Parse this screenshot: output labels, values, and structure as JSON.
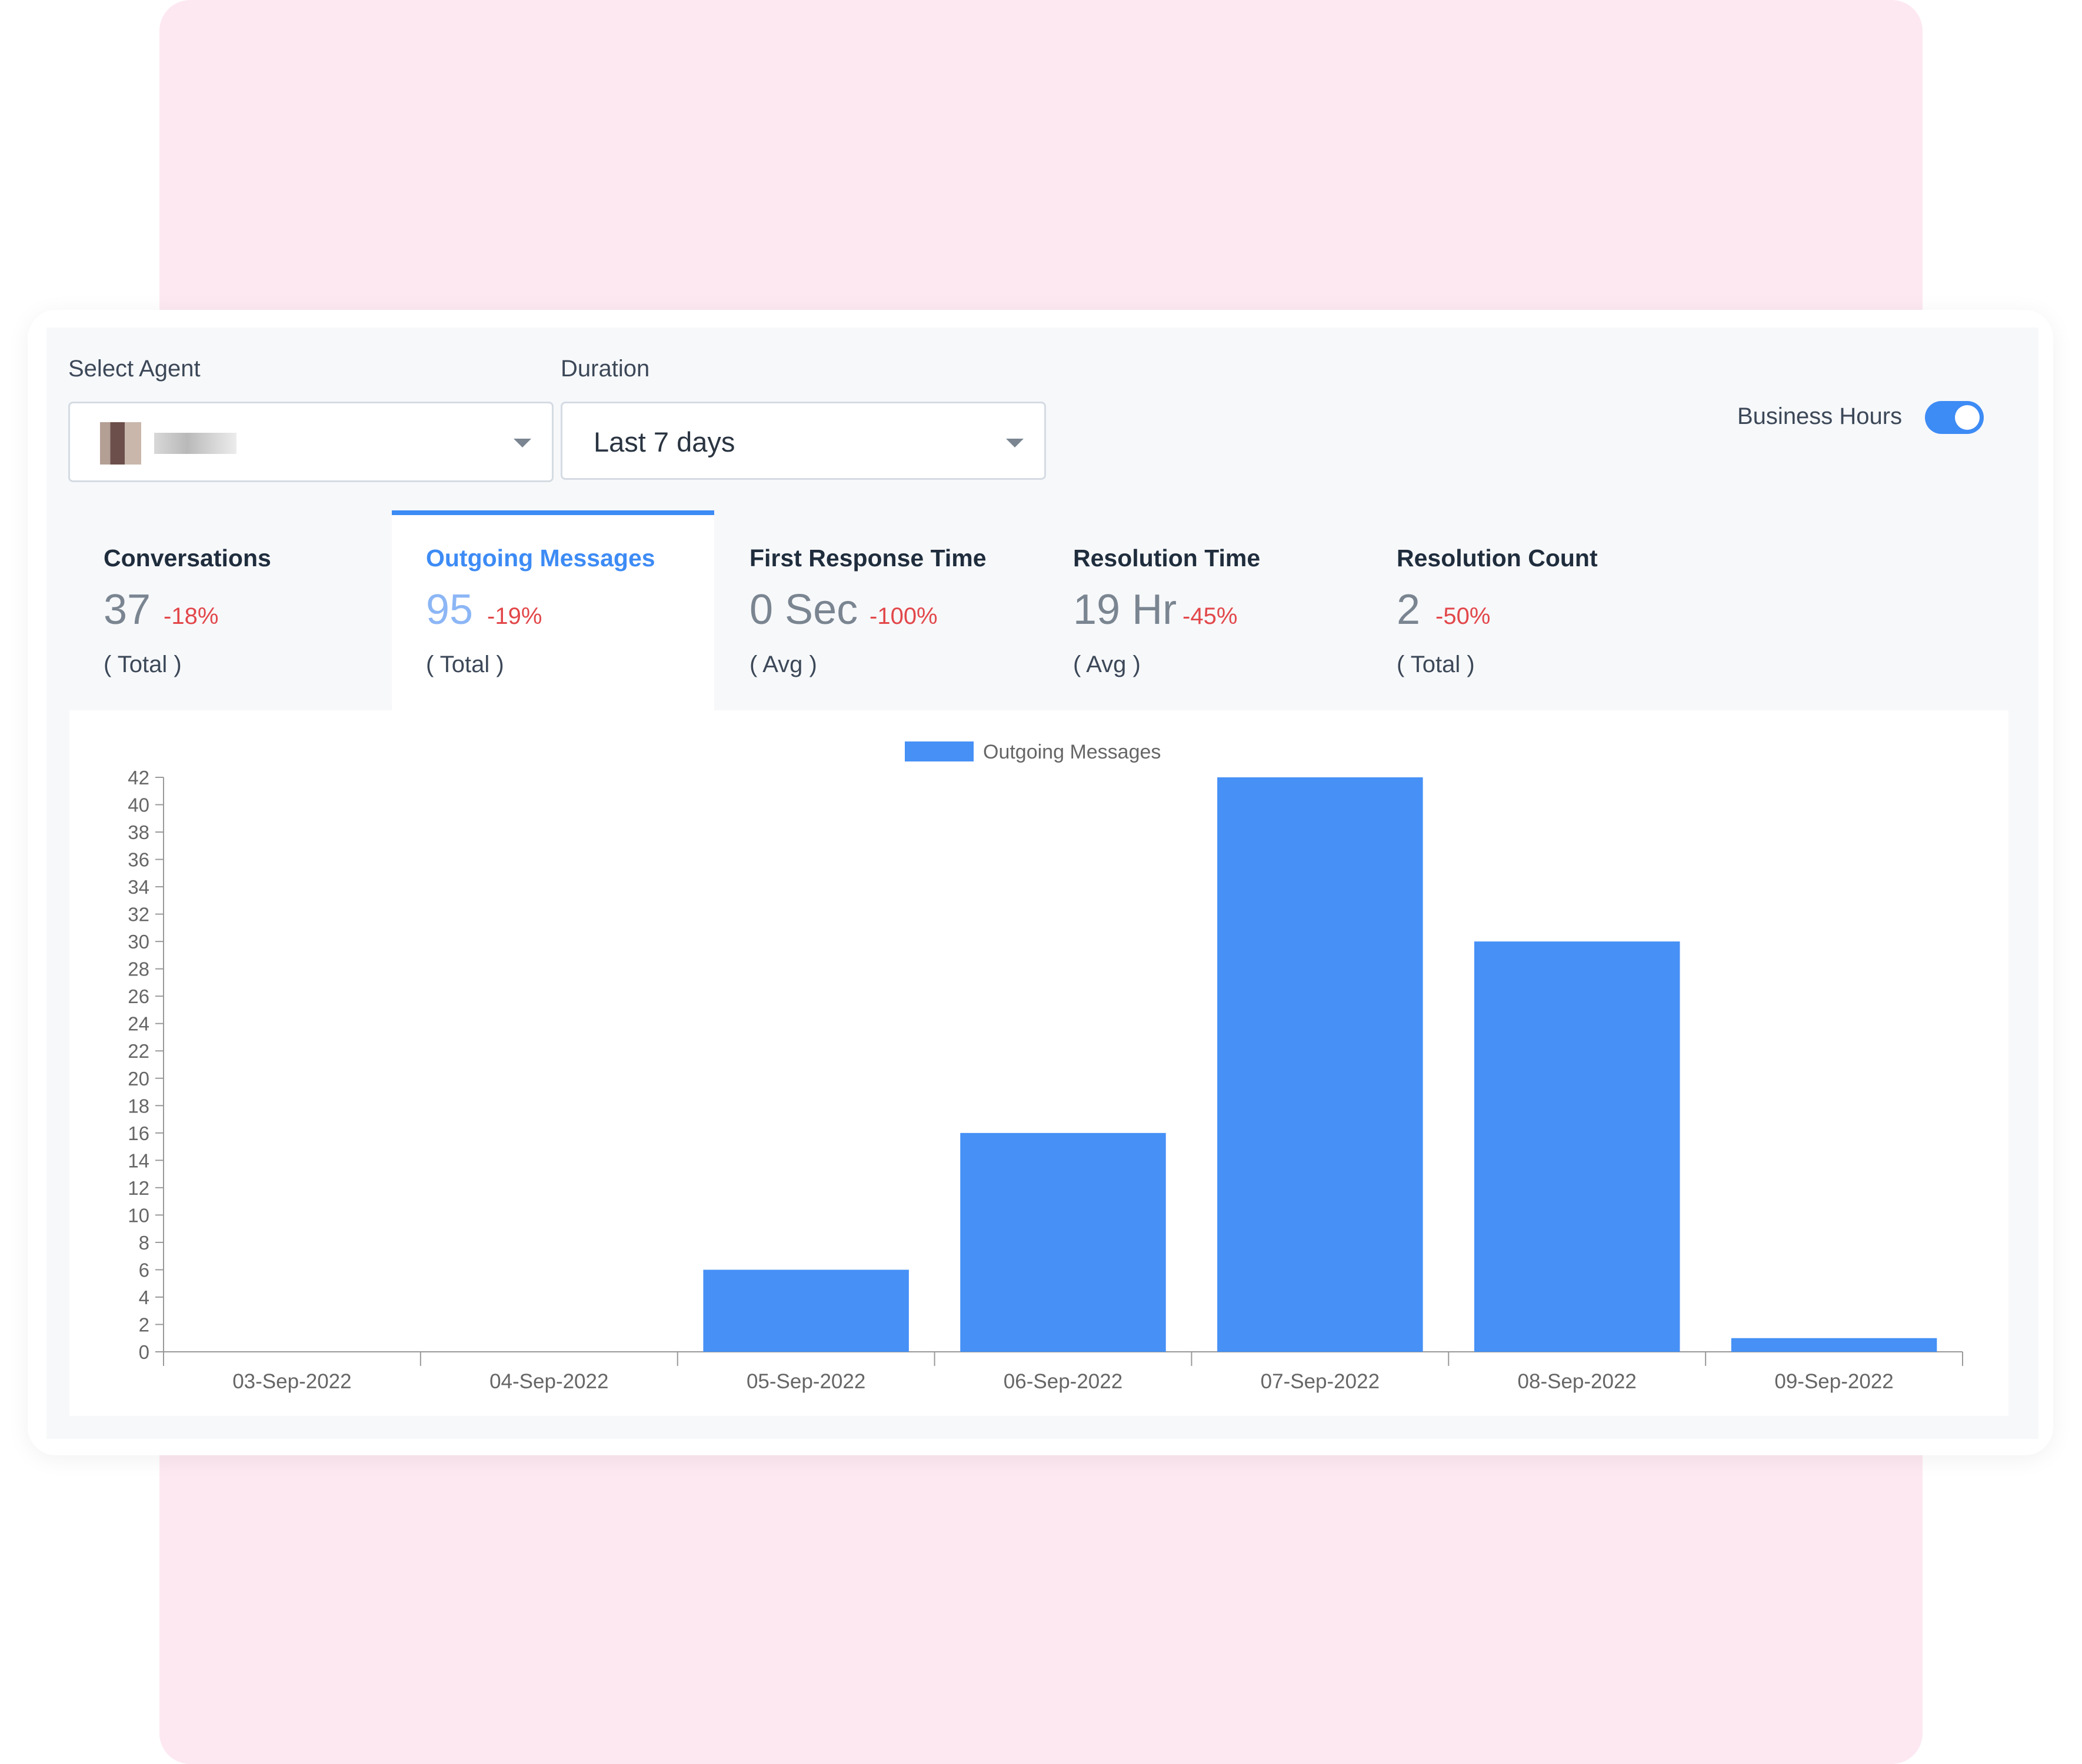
{
  "filters": {
    "agent_label": "Select Agent",
    "duration_label": "Duration",
    "duration_value": "Last 7 days",
    "business_hours_label": "Business Hours",
    "business_hours_on": true
  },
  "tabs": [
    {
      "title": "Conversations",
      "value": "37",
      "change": "-18%",
      "unit": "( Total )",
      "active": false
    },
    {
      "title": "Outgoing Messages",
      "value": "95",
      "change": "-19%",
      "unit": "( Total )",
      "active": true
    },
    {
      "title": "First Response Time",
      "value": "0 Sec",
      "change": "-100%",
      "unit": "( Avg )",
      "active": false
    },
    {
      "title": "Resolution Time",
      "value": "19 Hr",
      "change": "-45%",
      "unit": "( Avg )",
      "active": false
    },
    {
      "title": "Resolution Count",
      "value": "2",
      "change": "-50%",
      "unit": "( Total )",
      "active": false
    }
  ],
  "colors": {
    "accent": "#3d8bf5",
    "bar": "#4690f6",
    "negative": "#e2474a"
  },
  "chart_data": {
    "type": "bar",
    "categories": [
      "03-Sep-2022",
      "04-Sep-2022",
      "05-Sep-2022",
      "06-Sep-2022",
      "07-Sep-2022",
      "08-Sep-2022",
      "09-Sep-2022"
    ],
    "series": [
      {
        "name": "Outgoing Messages",
        "values": [
          0,
          0,
          6,
          16,
          42,
          30,
          1
        ]
      }
    ],
    "ylim": [
      0,
      42
    ],
    "yticks": [
      0,
      2,
      4,
      6,
      8,
      10,
      12,
      14,
      16,
      18,
      20,
      22,
      24,
      26,
      28,
      30,
      32,
      34,
      36,
      38,
      40,
      42
    ],
    "legend": "top-center",
    "grid": false
  }
}
